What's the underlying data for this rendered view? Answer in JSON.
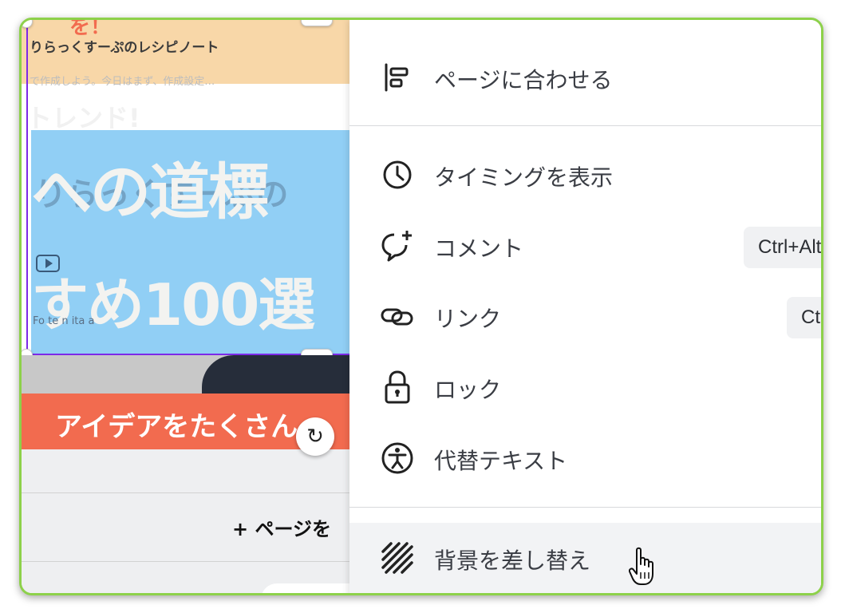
{
  "canvas": {
    "banner_top_text": "を！",
    "banner_title": "りらっくすーぷのレシピノート",
    "faded_subtitle": "で作成しよう。今日はまず、作成設定…",
    "faded_trend": "トレンド!",
    "hero_faint_text": "りらっくすーぷの",
    "hero_line1": "への道標",
    "hero_line2": "すめ100選",
    "hero_small_text": "Fo     te n     ita a",
    "red_band_text": "アイデアをたくさん",
    "add_page_label": "+ ページを"
  },
  "menu": {
    "items": [
      {
        "label": "ページに合わせる",
        "icon": "align-left-icon"
      },
      {
        "label": "タイミングを表示",
        "icon": "clock-icon"
      },
      {
        "label": "コメント",
        "icon": "comment-add-icon",
        "shortcut": "Ctrl+Alt+N"
      },
      {
        "label": "リンク",
        "icon": "link-icon",
        "shortcut": "Ctrl+K"
      },
      {
        "label": "ロック",
        "icon": "lock-icon"
      },
      {
        "label": "代替テキスト",
        "icon": "accessibility-icon"
      },
      {
        "label": "背景を差し替え",
        "icon": "hatch-icon"
      }
    ]
  },
  "colors": {
    "frame_border": "#8dd14a",
    "selection": "#7d2ae8",
    "hero_bg": "#91cff5",
    "banner_bg": "#f8d7a8",
    "red_band": "#f26b4f"
  }
}
